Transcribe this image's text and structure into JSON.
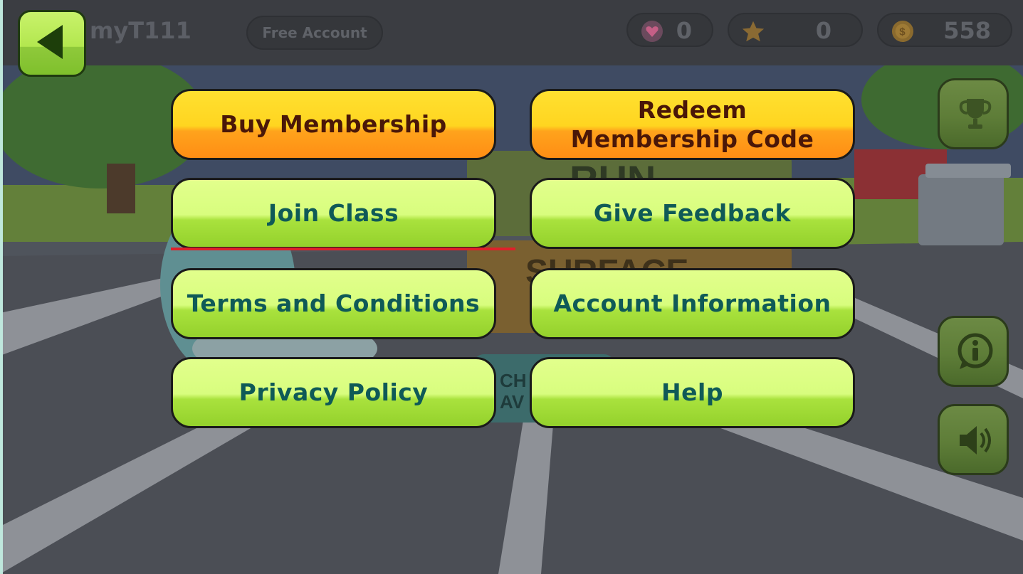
{
  "header": {
    "username": "myT111",
    "account_type": "Free Account",
    "hearts": "0",
    "stars": "0",
    "coins": "558"
  },
  "back_button": {
    "icon": "back-arrow-icon"
  },
  "menu": {
    "buy_membership": "Buy Membership",
    "redeem_line1": "Redeem",
    "redeem_line2": "Membership Code",
    "join_class": "Join Class",
    "give_feedback": "Give Feedback",
    "terms": "Terms and Conditions",
    "account_info": "Account Information",
    "privacy": "Privacy Policy",
    "help": "Help"
  },
  "background_text": {
    "run": "RUN",
    "surface": "SURFACE",
    "ch": "CH",
    "av": "AV"
  },
  "side_buttons": [
    "trophy-icon",
    "info-icon",
    "speaker-icon"
  ],
  "colors": {
    "green_button": "#d8fd7e",
    "yellow_button": "#ffd520",
    "button_text_green": "#0f5a57",
    "button_text_yellow": "#4a1708",
    "underline": "#e0202a"
  }
}
